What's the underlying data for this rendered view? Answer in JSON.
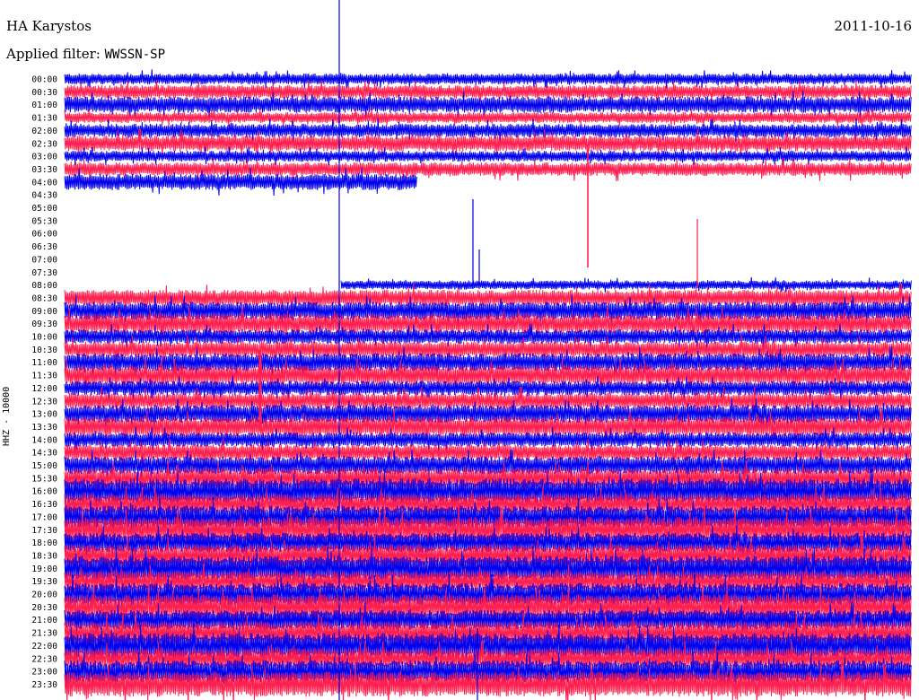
{
  "header": {
    "station": "HA Karystos",
    "date": "2011-10-16",
    "filter_label": "Applied filter:",
    "filter_value": "WWSSN-SP"
  },
  "chart_data": {
    "type": "line",
    "title": "HA Karystos",
    "subtitle": "Applied filter: WWSSN-SP",
    "ylabel": "HHZ - 10000",
    "row_labels": [
      "00:00",
      "00:30",
      "01:00",
      "01:30",
      "02:00",
      "02:30",
      "03:00",
      "03:30",
      "04:00",
      "04:30",
      "05:00",
      "05:30",
      "06:00",
      "06:30",
      "07:00",
      "07:30",
      "08:00",
      "08:30",
      "09:00",
      "09:30",
      "10:00",
      "10:30",
      "11:00",
      "11:30",
      "12:00",
      "12:30",
      "13:00",
      "13:30",
      "14:00",
      "14:30",
      "15:00",
      "15:30",
      "16:00",
      "16:30",
      "17:00",
      "17:30",
      "18:00",
      "18:30",
      "19:00",
      "19:30",
      "20:00",
      "20:30",
      "21:00",
      "21:30",
      "22:00",
      "22:30",
      "23:00",
      "23:30"
    ],
    "series_colors": [
      "#0000ee",
      "#ff1f4e"
    ],
    "gap": {
      "start": "04:00",
      "end": "08:00",
      "description": "no data between ~04:00 and ~08:00"
    },
    "grid": false
  }
}
